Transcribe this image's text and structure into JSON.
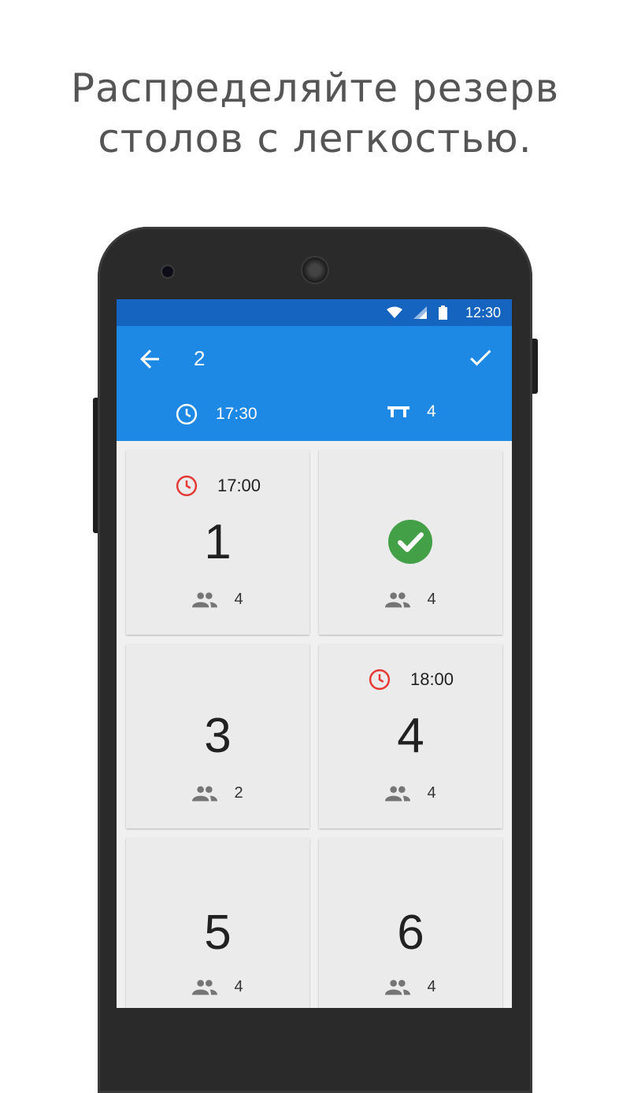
{
  "headline": {
    "line1": "Распределяйте резерв",
    "line2": "столов с легкостью."
  },
  "status_bar": {
    "time": "12:30",
    "icons": [
      "wifi-icon",
      "signal-icon",
      "battery-icon"
    ]
  },
  "app_bar": {
    "title": "2",
    "time": "17:30",
    "seats": "4",
    "back_icon": "arrow-back-icon",
    "confirm_icon": "check-icon"
  },
  "colors": {
    "status_bar": "#1565c0",
    "app_bar": "#1e88e5",
    "reserved_clock": "#e53935",
    "available_check": "#43a047",
    "card": "#ebebeb"
  },
  "tables": [
    {
      "number": "1",
      "reserved_time": "17:00",
      "guests": "4",
      "selected": false
    },
    {
      "number": "",
      "reserved_time": "",
      "guests": "4",
      "selected": true
    },
    {
      "number": "3",
      "reserved_time": "",
      "guests": "2",
      "selected": false
    },
    {
      "number": "4",
      "reserved_time": "18:00",
      "guests": "4",
      "selected": false
    },
    {
      "number": "5",
      "reserved_time": "",
      "guests": "4",
      "selected": false
    },
    {
      "number": "6",
      "reserved_time": "",
      "guests": "4",
      "selected": false
    }
  ]
}
